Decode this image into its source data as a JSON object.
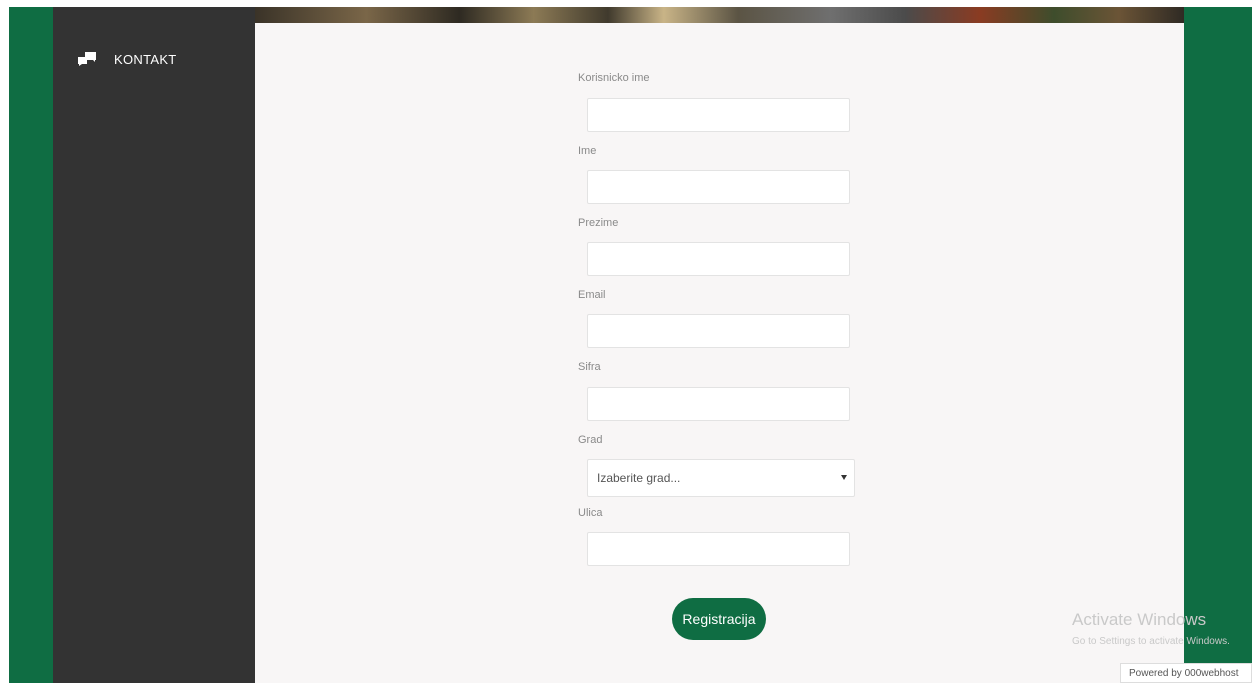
{
  "sidebar": {
    "top_item_label": "",
    "nav": [
      {
        "label": "KONTAKT",
        "icon": "chat-icon"
      }
    ]
  },
  "form": {
    "fields": [
      {
        "label": "Korisnicko ime",
        "value": ""
      },
      {
        "label": "Ime",
        "value": ""
      },
      {
        "label": "Prezime",
        "value": ""
      },
      {
        "label": "Email",
        "value": ""
      },
      {
        "label": "Sifra",
        "value": ""
      }
    ],
    "city": {
      "label": "Grad",
      "selected": "Izaberite grad..."
    },
    "street": {
      "label": "Ulica",
      "value": ""
    },
    "submit_label": "Registracija"
  },
  "watermark": {
    "title": "Activate Windows",
    "subtitle": "Go to Settings to activate Windows."
  },
  "powered_by": "Powered by 000webhost",
  "colors": {
    "brand_green": "#0f6d43",
    "sidebar_bg": "#333333",
    "content_bg": "#f8f6f6"
  }
}
